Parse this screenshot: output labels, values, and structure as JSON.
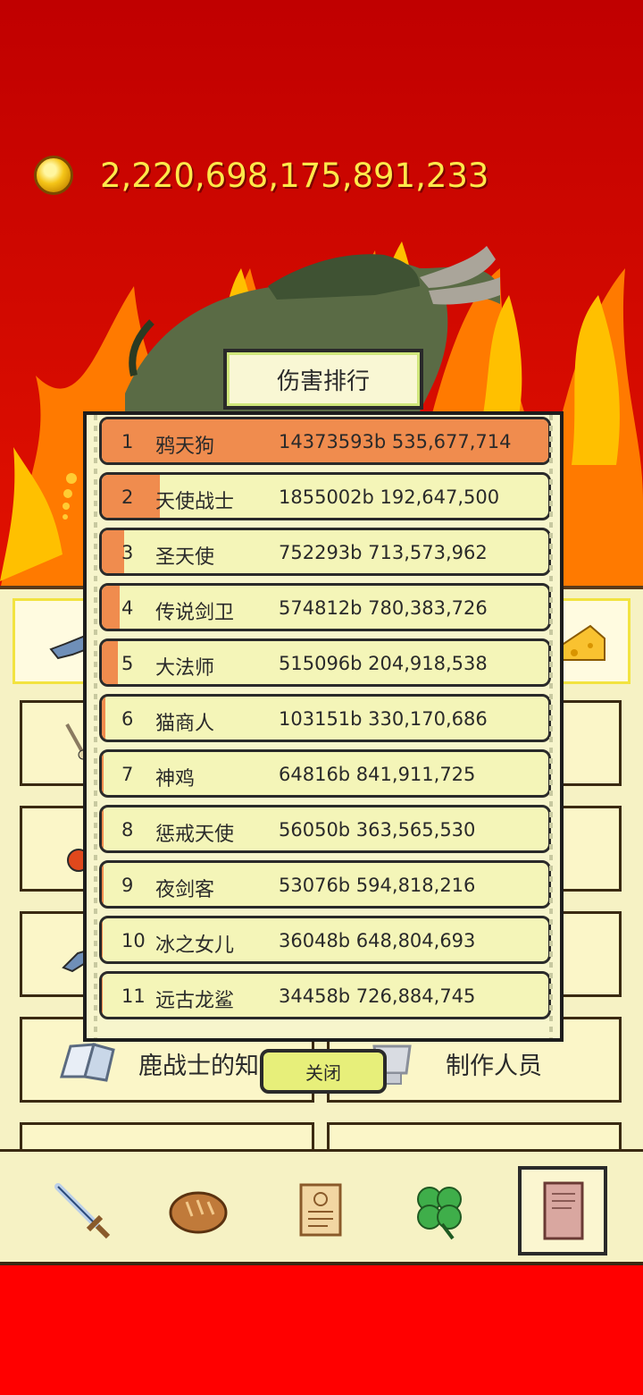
{
  "gold": {
    "amount": "2,220,698,175,891,233"
  },
  "modal": {
    "title": "伤害排行",
    "close_label": "关闭",
    "rows": [
      {
        "rank": "1",
        "name": "鸦天狗",
        "damage": "14373593b 535,677,714",
        "share": 1.0
      },
      {
        "rank": "2",
        "name": "天使战士",
        "damage": "1855002b 192,647,500",
        "share": 0.13
      },
      {
        "rank": "3",
        "name": "圣天使",
        "damage": "752293b 713,573,962",
        "share": 0.05
      },
      {
        "rank": "4",
        "name": "传说剑卫",
        "damage": "574812b 780,383,726",
        "share": 0.04
      },
      {
        "rank": "5",
        "name": "大法师",
        "damage": "515096b 204,918,538",
        "share": 0.036
      },
      {
        "rank": "6",
        "name": "猫商人",
        "damage": "103151b 330,170,686",
        "share": 0.007
      },
      {
        "rank": "7",
        "name": "神鸡",
        "damage": "64816b 841,911,725",
        "share": 0.0045
      },
      {
        "rank": "8",
        "name": "惩戒天使",
        "damage": "56050b 363,565,530",
        "share": 0.0039
      },
      {
        "rank": "9",
        "name": "夜剑客",
        "damage": "53076b 594,818,216",
        "share": 0.0037
      },
      {
        "rank": "10",
        "name": "冰之女儿",
        "damage": "36048b 648,804,693",
        "share": 0.0025
      },
      {
        "rank": "11",
        "name": "远古龙鲨",
        "damage": "34458b 726,884,745",
        "share": 0.0024
      }
    ]
  },
  "menu": {
    "knowledge_label": "鹿战士的知识",
    "credits_label": "制作人员"
  },
  "toolbar": {
    "items": [
      {
        "icon": "sword-icon"
      },
      {
        "icon": "bread-icon"
      },
      {
        "icon": "scroll-icon"
      },
      {
        "icon": "clover-icon"
      },
      {
        "icon": "book-icon",
        "active": true
      }
    ]
  },
  "colors": {
    "background": "#e00000",
    "bar": "#f08c4e",
    "row": "#f4f5b8",
    "gold_text": "#ffe94a"
  }
}
